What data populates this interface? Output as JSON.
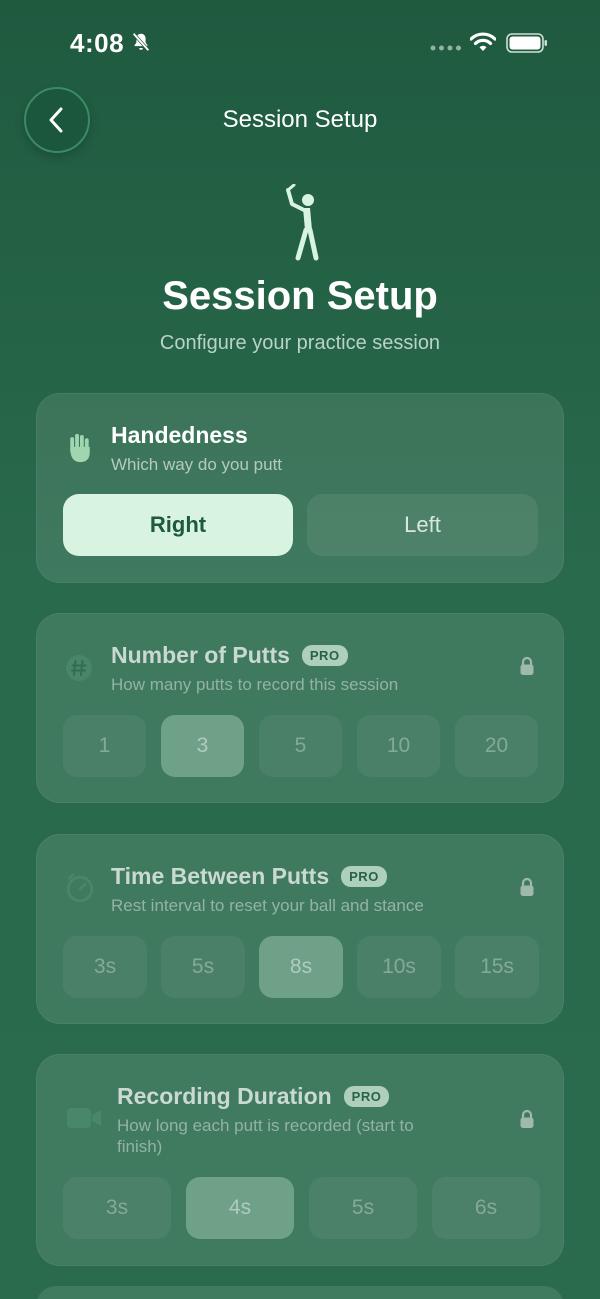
{
  "status_bar": {
    "time": "4:08",
    "icons": [
      "bell-slash-icon",
      "cellular-dots-icon",
      "wifi-icon",
      "battery-icon"
    ]
  },
  "nav": {
    "back_icon": "chevron-left-icon",
    "title": "Session Setup"
  },
  "hero": {
    "icon": "golfer-icon",
    "title": "Session Setup",
    "subtitle": "Configure your practice session"
  },
  "handedness": {
    "icon": "hand-icon",
    "title": "Handedness",
    "subtitle": "Which way do you putt",
    "options": [
      "Right",
      "Left"
    ],
    "selected": "Right"
  },
  "num_putts": {
    "icon": "hash-icon",
    "title": "Number of Putts",
    "badge": "PRO",
    "subtitle": "How many putts to record this session",
    "options": [
      "1",
      "3",
      "5",
      "10",
      "20"
    ],
    "selected": "3",
    "locked": true
  },
  "time_between": {
    "icon": "timer-icon",
    "title": "Time Between Putts",
    "badge": "PRO",
    "subtitle": "Rest interval to reset your ball and stance",
    "options": [
      "3s",
      "5s",
      "8s",
      "10s",
      "15s"
    ],
    "selected": "8s",
    "locked": true
  },
  "recording": {
    "icon": "video-camera-icon",
    "title": "Recording Duration",
    "badge": "PRO",
    "subtitle": "How long each putt is recorded (start to finish)",
    "options": [
      "3s",
      "4s",
      "5s",
      "6s"
    ],
    "selected": "4s",
    "locked": true
  },
  "colors": {
    "background": "#1f5a3f",
    "accent": "#d8f3df",
    "accent_text": "#1e5a3e"
  }
}
